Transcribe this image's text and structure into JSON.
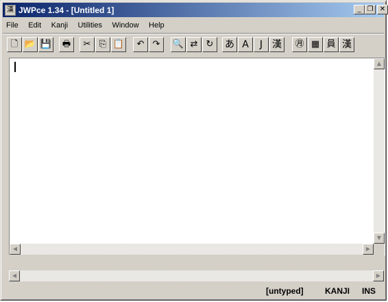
{
  "window": {
    "title": "JWPce 1.34 - [Untitled 1]",
    "app_icon": "漢"
  },
  "title_buttons": {
    "minimize": "_",
    "restore": "❐",
    "close": "✕"
  },
  "menu": [
    {
      "label": "File"
    },
    {
      "label": "Edit"
    },
    {
      "label": "Kanji"
    },
    {
      "label": "Utilities"
    },
    {
      "label": "Window"
    },
    {
      "label": "Help"
    }
  ],
  "toolbar": {
    "new": {
      "icon": "new-file-icon",
      "glyph": "🗋"
    },
    "open": {
      "icon": "open-folder-icon",
      "glyph": "📂"
    },
    "save": {
      "icon": "save-icon",
      "glyph": "💾"
    },
    "print": {
      "icon": "print-icon",
      "glyph": "🖶"
    },
    "cut": {
      "icon": "cut-icon",
      "glyph": "✂"
    },
    "copy": {
      "icon": "copy-icon",
      "glyph": "⎘"
    },
    "paste": {
      "icon": "paste-icon",
      "glyph": "📋"
    },
    "undo": {
      "icon": "undo-icon",
      "glyph": "↶"
    },
    "redo": {
      "icon": "redo-icon",
      "glyph": "↷"
    },
    "find": {
      "icon": "search-icon",
      "glyph": "🔍"
    },
    "replace": {
      "icon": "replace-icon",
      "glyph": "⇄"
    },
    "find_next": {
      "icon": "find-next-icon",
      "glyph": "↻"
    },
    "hiragana": {
      "label": "あ"
    },
    "ascii": {
      "label": "A"
    },
    "jis": {
      "label": "J"
    },
    "kanji": {
      "label": "漢"
    },
    "search_kanji": {
      "icon": "kanji-search-icon",
      "glyph": "㊊"
    },
    "radical": {
      "icon": "radical-lookup-icon",
      "glyph": "▦"
    },
    "index": {
      "icon": "index-icon",
      "glyph": "員"
    },
    "kanji_info": {
      "icon": "kanji-info-icon",
      "glyph": "漢"
    }
  },
  "scroll": {
    "up": "▲",
    "down": "▼",
    "left": "◀",
    "right": "▶"
  },
  "status": {
    "mode": "[untyped]",
    "input": "KANJI",
    "insert": "INS"
  },
  "colors": {
    "title_start": "#0a246a",
    "title_end": "#a6caf0",
    "face": "#d4d0c8"
  }
}
